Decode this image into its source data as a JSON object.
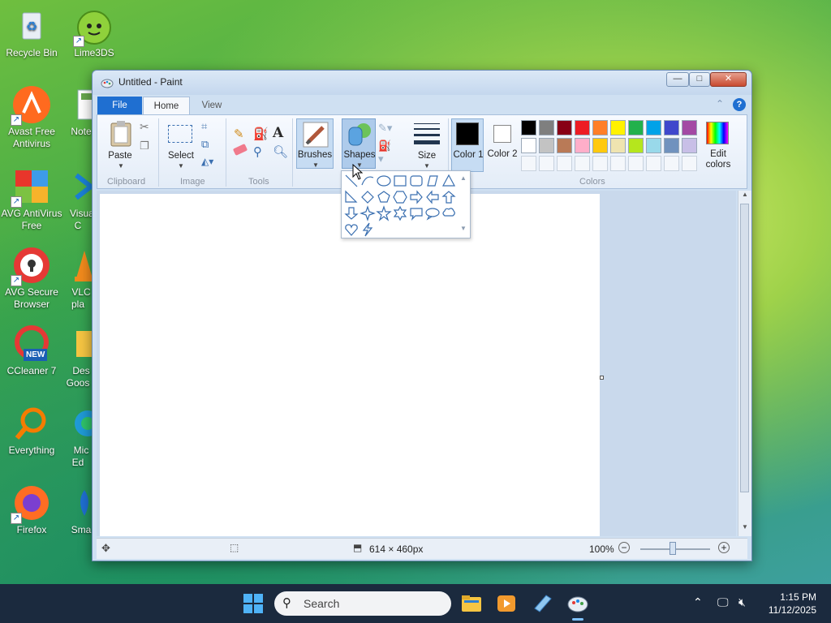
{
  "desktop": {
    "icons": [
      {
        "label": "Recycle Bin"
      },
      {
        "label": "Lime3DS"
      },
      {
        "label": "Avast Free Antivirus"
      },
      {
        "label": "Note"
      },
      {
        "label": "AVG AntiVirus Free"
      },
      {
        "label": "Visual C"
      },
      {
        "label": "AVG Secure Browser"
      },
      {
        "label": "VLC pla"
      },
      {
        "label": "CCleaner 7"
      },
      {
        "label": "Des Goos"
      },
      {
        "label": "Everything"
      },
      {
        "label": "Mic Ed"
      },
      {
        "label": "Firefox"
      },
      {
        "label": "Sma"
      }
    ],
    "ccleaner_badge": "NEW"
  },
  "window": {
    "title": "Untitled - Paint",
    "controls": {
      "minimize": "—",
      "maximize": "□",
      "close": "✕"
    },
    "help": "?"
  },
  "ribbon": {
    "tabs": {
      "file": "File",
      "home": "Home",
      "view": "View"
    },
    "groups": {
      "clipboard": "Clipboard",
      "image": "Image",
      "tools": "Tools",
      "colors": "Colors"
    },
    "buttons": {
      "paste": "Paste",
      "select": "Select",
      "brushes": "Brushes",
      "shapes": "Shapes",
      "size": "Size",
      "color1": "Color 1",
      "color2": "Color 2",
      "edit_colors": "Edit colors"
    },
    "color1_value": "#000000",
    "color2_value": "#ffffff",
    "palette_row1": [
      "#000000",
      "#7f7f7f",
      "#880015",
      "#ed1c24",
      "#ff7f27",
      "#fff200",
      "#22b14c",
      "#00a2e8",
      "#3f48cc",
      "#a349a4"
    ],
    "palette_row2": [
      "#ffffff",
      "#c3c3c3",
      "#b97a57",
      "#ffaec9",
      "#ffc90e",
      "#efe4b0",
      "#b5e61d",
      "#99d9ea",
      "#7092be",
      "#c8bfe7"
    ],
    "palette_row3_count_custom": 10
  },
  "shapes_dropdown": {
    "shapes": [
      "line-shape-icon",
      "curve-shape-icon",
      "oval-shape-icon",
      "rectangle-shape-icon",
      "rounded-rectangle-shape-icon",
      "polygon-shape-icon",
      "triangle-shape-icon",
      "right-triangle-shape-icon",
      "diamond-shape-icon",
      "pentagon-shape-icon",
      "hexagon-shape-icon",
      "right-arrow-shape-icon",
      "left-arrow-shape-icon",
      "up-arrow-shape-icon",
      "down-arrow-shape-icon",
      "four-point-star-shape-icon",
      "five-point-star-shape-icon",
      "six-point-star-shape-icon",
      "rounded-callout-shape-icon",
      "oval-callout-shape-icon",
      "cloud-callout-shape-icon",
      "heart-shape-icon",
      "lightning-shape-icon"
    ]
  },
  "statusbar": {
    "canvas_size": "614 × 460px",
    "zoom": "100%",
    "zoom_out": "−",
    "zoom_in": "+"
  },
  "taskbar": {
    "search_placeholder": "Search",
    "time": "1:15 PM",
    "date": "11/12/2025"
  }
}
